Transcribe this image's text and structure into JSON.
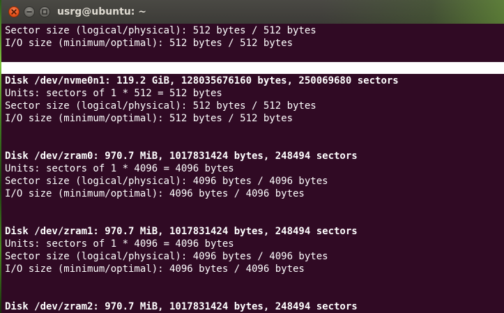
{
  "window": {
    "title": "usrg@ubuntu: ~"
  },
  "terminal": {
    "lines": [
      {
        "text": "Sector size (logical/physical): 512 bytes / 512 bytes",
        "bold": false
      },
      {
        "text": "I/O size (minimum/optimal): 512 bytes / 512 bytes",
        "bold": false
      },
      {
        "text": "Disk /dev/nvme0n1: 119.2 GiB, 128035676160 bytes, 250069680 sectors",
        "bold": true
      },
      {
        "text": "Units: sectors of 1 * 512 = 512 bytes",
        "bold": false
      },
      {
        "text": "Sector size (logical/physical): 512 bytes / 512 bytes",
        "bold": false
      },
      {
        "text": "I/O size (minimum/optimal): 512 bytes / 512 bytes",
        "bold": false
      },
      {
        "text": "Disk /dev/zram0: 970.7 MiB, 1017831424 bytes, 248494 sectors",
        "bold": true
      },
      {
        "text": "Units: sectors of 1 * 4096 = 4096 bytes",
        "bold": false
      },
      {
        "text": "Sector size (logical/physical): 4096 bytes / 4096 bytes",
        "bold": false
      },
      {
        "text": "I/O size (minimum/optimal): 4096 bytes / 4096 bytes",
        "bold": false
      },
      {
        "text": "Disk /dev/zram1: 970.7 MiB, 1017831424 bytes, 248494 sectors",
        "bold": true
      },
      {
        "text": "Units: sectors of 1 * 4096 = 4096 bytes",
        "bold": false
      },
      {
        "text": "Sector size (logical/physical): 4096 bytes / 4096 bytes",
        "bold": false
      },
      {
        "text": "I/O size (minimum/optimal): 4096 bytes / 4096 bytes",
        "bold": false
      },
      {
        "text": "Disk /dev/zram2: 970.7 MiB, 1017831424 bytes, 248494 sectors",
        "bold": true
      }
    ]
  },
  "colors": {
    "terminal_background": "#300a24",
    "terminal_text": "#ffffff",
    "titlebar": "#3c3b37",
    "close_button": "#e9541e",
    "highlight_bar": "#ffffff"
  },
  "icons": {
    "close": "close-icon",
    "minimize": "minimize-icon",
    "maximize": "maximize-icon"
  }
}
